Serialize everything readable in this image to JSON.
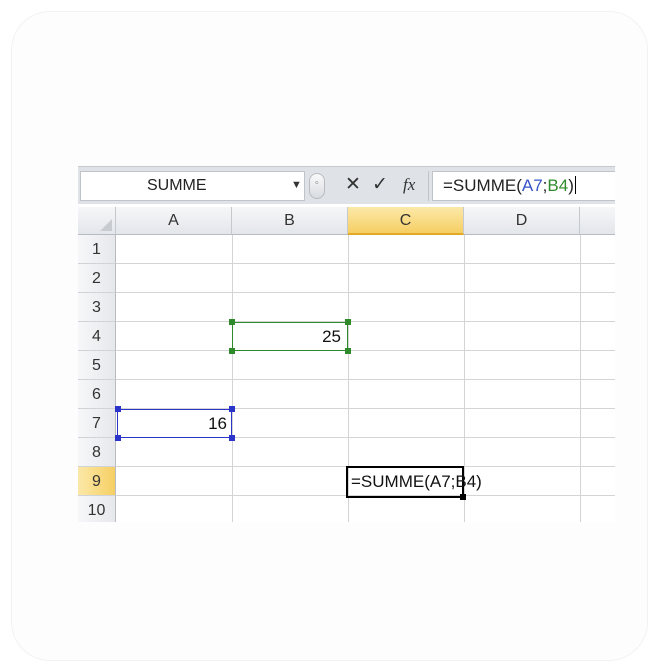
{
  "name_box": {
    "value": "SUMME",
    "dropdown_icon": "chevron-down-icon"
  },
  "formula_bar": {
    "cancel_icon": "✕",
    "enter_icon": "✓",
    "fx_label": "fx",
    "formula_prefix": "=SUMME(",
    "ref1": "A7",
    "sep": ";",
    "ref2": "B4",
    "suffix": ")"
  },
  "columns": [
    "A",
    "B",
    "C",
    "D"
  ],
  "rows": [
    "1",
    "2",
    "3",
    "4",
    "5",
    "6",
    "7",
    "8",
    "9",
    "10"
  ],
  "selected_column": "C",
  "selected_row": "9",
  "cells": {
    "B4": "25",
    "A7": "16",
    "C9": "=SUMME(A7;B4)"
  },
  "colors": {
    "ref1": "#3454c8",
    "ref2": "#2f8a2b",
    "header_selected": "#f6cf63"
  }
}
